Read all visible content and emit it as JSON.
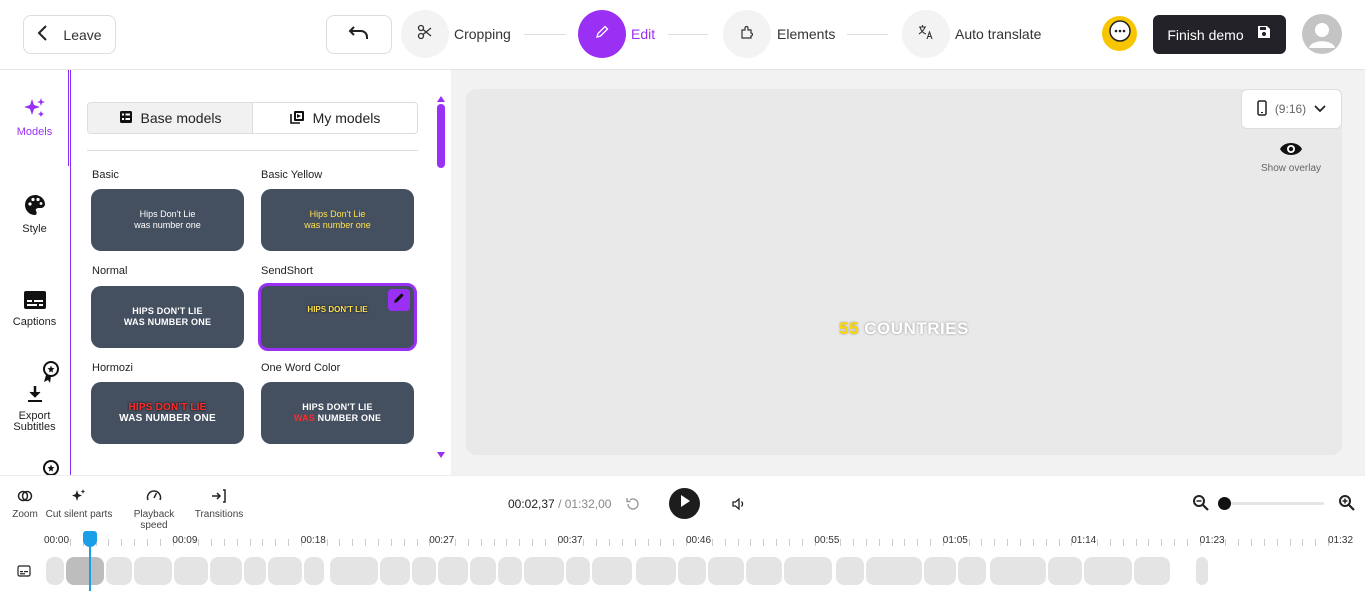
{
  "header": {
    "leave_label": "Leave",
    "steps": [
      {
        "label": "Cropping",
        "icon": "scissors-icon",
        "active": false
      },
      {
        "label": "Edit",
        "icon": "pencil-icon",
        "active": true
      },
      {
        "label": "Elements",
        "icon": "puzzle-icon",
        "active": false
      },
      {
        "label": "Auto translate",
        "icon": "translate-icon",
        "active": false
      }
    ],
    "finish_label": "Finish demo",
    "accent": "#9b30f5"
  },
  "leftnav": {
    "items": [
      {
        "label": "Models",
        "icon": "sparkles-icon",
        "active": true
      },
      {
        "label": "Style",
        "icon": "palette-icon"
      },
      {
        "label": "Captions",
        "icon": "subtitles-icon"
      },
      {
        "label": "Export Subtitles",
        "icon": "download-icon"
      }
    ]
  },
  "panel": {
    "tabs": [
      {
        "label": "Base models",
        "active": true
      },
      {
        "label": "My models",
        "active": false
      }
    ],
    "models": [
      {
        "title": "Basic",
        "line1": "Hips Don't Lie",
        "line2": "was number one",
        "style": "basic"
      },
      {
        "title": "Basic Yellow",
        "line1": "Hips Don't Lie",
        "line2": "was number one",
        "style": "yellow"
      },
      {
        "title": "Normal",
        "line1": "HIPS DON'T LIE",
        "line2": "WAS NUMBER ONE",
        "style": "normal"
      },
      {
        "title": "SendShort",
        "line1": "HIPS DON'T LIE",
        "line2": "",
        "style": "sendshort",
        "selected": true
      },
      {
        "title": "Hormozi",
        "line1": "HIPS DON'T LIE",
        "line2": "WAS NUMBER ONE",
        "style": "hormozi"
      },
      {
        "title": "One Word Color",
        "line1": "HIPS DON'T LIE",
        "line2_highlight": "WAS",
        "line2_rest": " NUMBER ONE",
        "style": "oneword"
      }
    ]
  },
  "preview": {
    "ratio_label": "(9:16)",
    "show_overlay_label": "Show overlay",
    "caption_number": "55",
    "caption_word": "COUNTRIES"
  },
  "toolbar": {
    "tools": [
      {
        "label": "Zoom",
        "icon": "zoom-coins-icon"
      },
      {
        "label": "Cut silent parts",
        "icon": "sparkles-small-icon"
      },
      {
        "label": "Playback speed",
        "icon": "gauge-icon"
      },
      {
        "label": "Transitions",
        "icon": "transitions-icon"
      }
    ],
    "current_time": "00:02,37",
    "separator": "/",
    "total_time": "01:32,00",
    "zoom_level": 0
  },
  "timeline": {
    "ticks": [
      "00:00",
      "00:09",
      "00:18",
      "00:27",
      "00:37",
      "00:46",
      "00:55",
      "01:05",
      "01:14",
      "01:23",
      "01:32"
    ],
    "playhead_seconds": 2.37,
    "duration_seconds": 92
  }
}
